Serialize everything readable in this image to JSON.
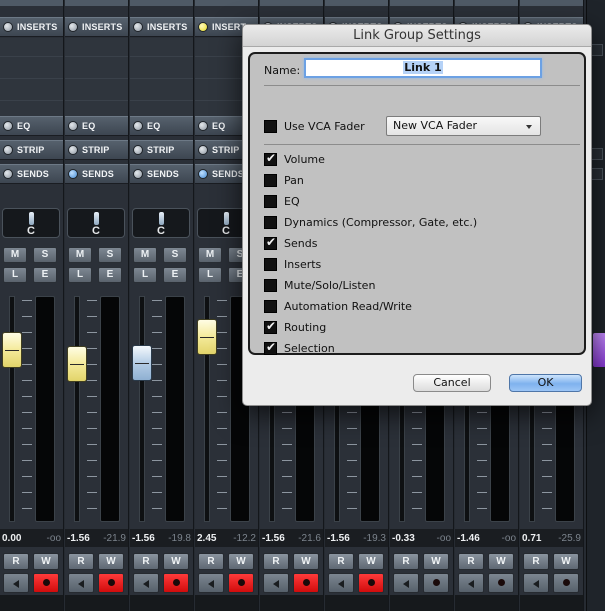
{
  "mixer": {
    "section_labels": {
      "inserts": "INSERTS",
      "eq": "EQ",
      "strip": "STRIP",
      "sends": "SENDS"
    },
    "top_row_labels": [
      "INSERTS",
      "INSERTS",
      "INSERTS",
      "INSERT"
    ],
    "solo_buttons": {
      "mute": "M",
      "solo": "S",
      "listen": "L",
      "edit": "E"
    },
    "rw_buttons": {
      "read": "R",
      "write": "W"
    },
    "channels": [
      {
        "pan": "C",
        "vol": "0.00",
        "peak": "-oo",
        "rec_on": true,
        "fader_color": "yellow",
        "top_led": "white"
      },
      {
        "pan": "C",
        "vol": "-1.56",
        "peak": "-21.9",
        "rec_on": true,
        "fader_color": "yellow",
        "top_led": "white"
      },
      {
        "pan": "C",
        "vol": "-1.56",
        "peak": "-19.8",
        "rec_on": true,
        "fader_color": "blue",
        "top_led": "white"
      },
      {
        "pan": "C",
        "vol": "2.45",
        "peak": "-12.2",
        "rec_on": true,
        "fader_color": "yellow",
        "top_led": "yellow"
      },
      {
        "pan": "",
        "vol": "-1.56",
        "peak": "-21.6",
        "rec_on": true,
        "fader_color": "none",
        "top_led": "white"
      },
      {
        "pan": "",
        "vol": "-1.56",
        "peak": "-19.3",
        "rec_on": true,
        "fader_color": "none",
        "top_led": "white"
      },
      {
        "pan": "",
        "vol": "-0.33",
        "peak": "-oo",
        "rec_on": false,
        "fader_color": "none",
        "top_led": "white"
      },
      {
        "pan": "",
        "vol": "-1.46",
        "peak": "-oo",
        "rec_on": false,
        "fader_color": "none",
        "top_led": "white"
      },
      {
        "pan": "",
        "vol": "0.71",
        "peak": "-25.9",
        "rec_on": false,
        "fader_color": "none",
        "top_led": "white"
      }
    ],
    "colors": {
      "rec_active": "#e01818",
      "fader_yellow": "#f4ea9a",
      "fader_blue": "#b4cde6",
      "right_accent": "#a25ce6"
    }
  },
  "dialog": {
    "title": "Link Group Settings",
    "name_label": "Name:",
    "name_value": "Link 1",
    "vca": {
      "label": "Use VCA Fader",
      "checked": false,
      "select_value": "New VCA Fader"
    },
    "options": [
      {
        "label": "Volume",
        "checked": true
      },
      {
        "label": "Pan",
        "checked": false
      },
      {
        "label": "EQ",
        "checked": false
      },
      {
        "label": "Dynamics (Compressor, Gate, etc.)",
        "checked": false
      },
      {
        "label": "Sends",
        "checked": true
      },
      {
        "label": "Inserts",
        "checked": false
      },
      {
        "label": "Mute/Solo/Listen",
        "checked": false
      },
      {
        "label": "Automation Read/Write",
        "checked": false
      },
      {
        "label": "Routing",
        "checked": true
      },
      {
        "label": "Selection",
        "checked": true
      }
    ],
    "cancel_label": "Cancel",
    "ok_label": "OK"
  }
}
